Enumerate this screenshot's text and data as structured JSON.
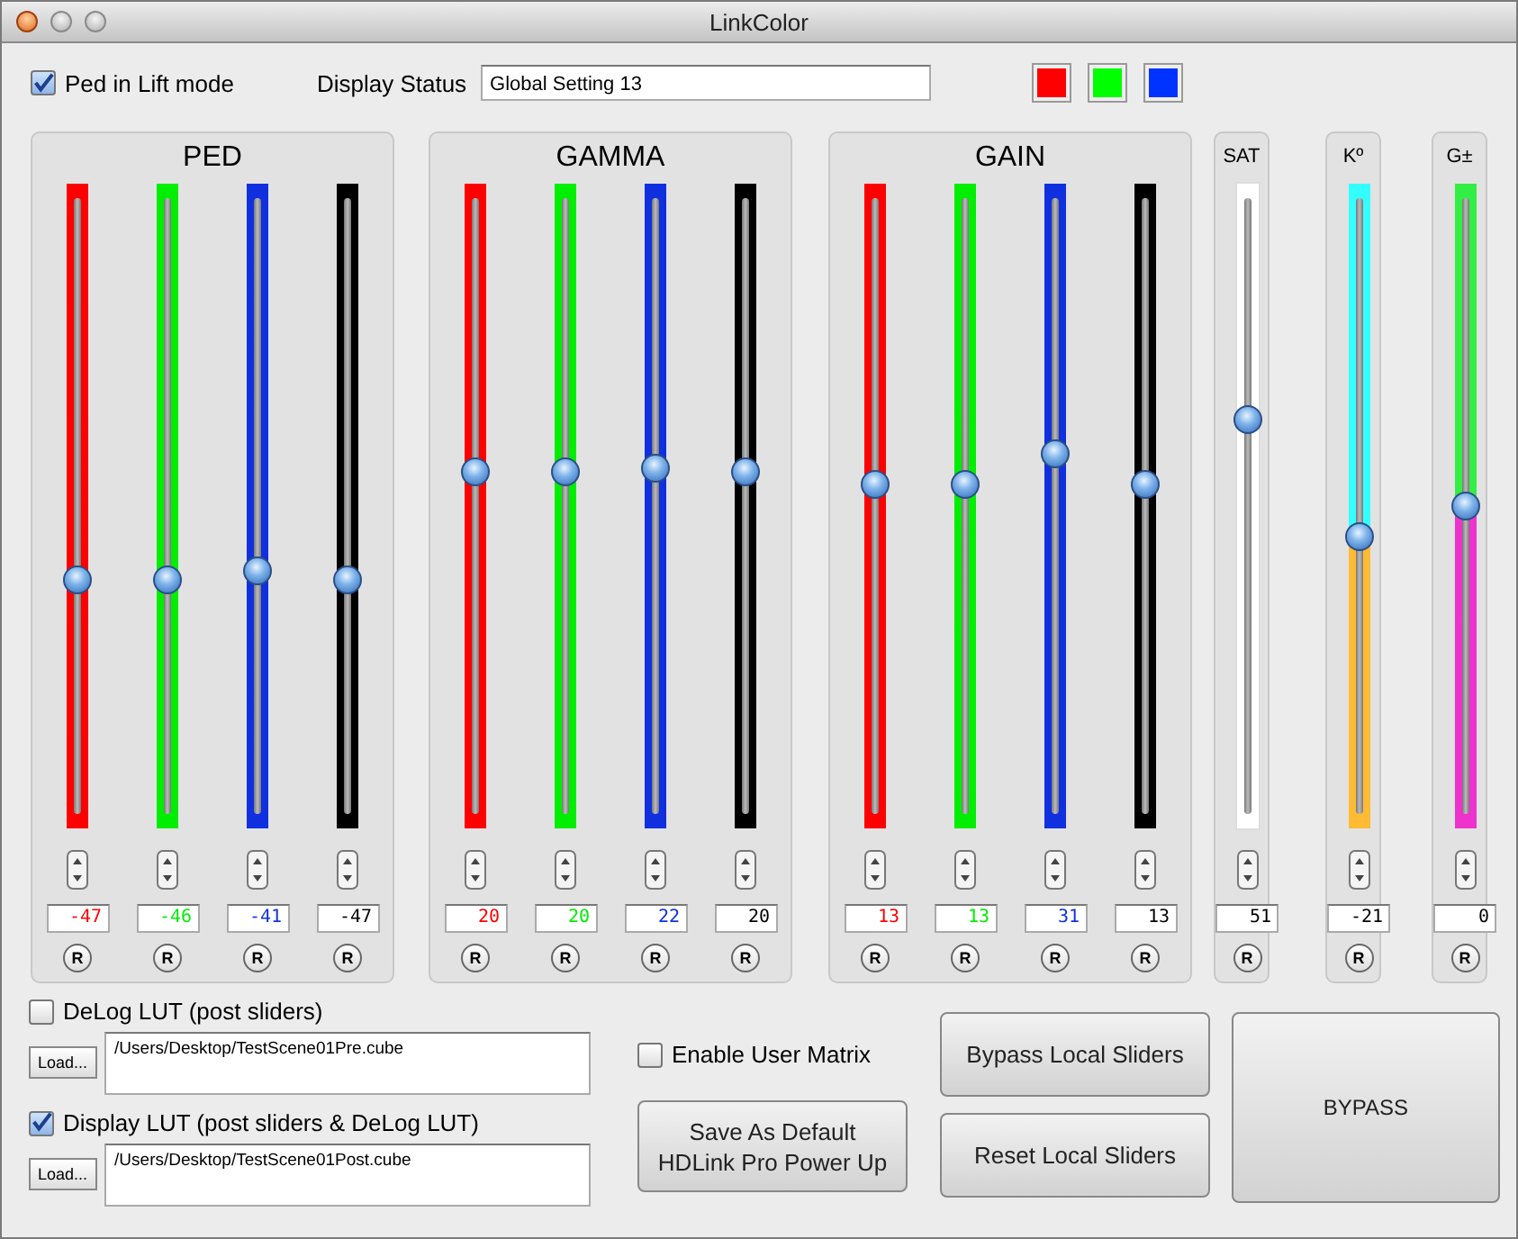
{
  "window": {
    "title": "LinkColor"
  },
  "top": {
    "ped_lift": {
      "label": "Ped in Lift mode",
      "checked": true
    },
    "status_label": "Display Status",
    "status_value": "Global Setting 13",
    "swatches": [
      {
        "color": "#ff0000"
      },
      {
        "color": "#00ff00"
      },
      {
        "color": "#0033ff"
      }
    ]
  },
  "groups": [
    {
      "title": "PED",
      "kind": "rgb",
      "channels": [
        {
          "color": "#ff0000",
          "level": 0.38,
          "value": "-47",
          "reset": "R"
        },
        {
          "color": "#00ee00",
          "level": 0.38,
          "value": "-46",
          "reset": "R"
        },
        {
          "color": "#1030e0",
          "level": 0.395,
          "value": "-41",
          "reset": "R"
        },
        {
          "color": "#000000",
          "level": 0.38,
          "value": "-47",
          "reset": "R"
        }
      ]
    },
    {
      "title": "GAMMA",
      "kind": "rgb",
      "channels": [
        {
          "color": "#ff0000",
          "level": 0.555,
          "value": "20",
          "reset": "R"
        },
        {
          "color": "#00ee00",
          "level": 0.555,
          "value": "20",
          "reset": "R"
        },
        {
          "color": "#1030e0",
          "level": 0.56,
          "value": "22",
          "reset": "R"
        },
        {
          "color": "#000000",
          "level": 0.555,
          "value": "20",
          "reset": "R"
        }
      ]
    },
    {
      "title": "GAIN",
      "kind": "rgb",
      "channels": [
        {
          "color": "#ff0000",
          "level": 0.535,
          "value": "13",
          "reset": "R"
        },
        {
          "color": "#00ee00",
          "level": 0.535,
          "value": "13",
          "reset": "R"
        },
        {
          "color": "#1030e0",
          "level": 0.585,
          "value": "31",
          "reset": "R"
        },
        {
          "color": "#000000",
          "level": 0.535,
          "value": "13",
          "reset": "R"
        }
      ]
    },
    {
      "title": "SAT",
      "kind": "single",
      "channels": [
        {
          "color": "#ffffff",
          "level": 0.64,
          "value": "51",
          "reset": "R"
        }
      ]
    },
    {
      "title": "Kº",
      "kind": "single",
      "channels": [
        {
          "segments": [
            {
              "color": "#33ffff"
            },
            {
              "color": "#ffbb33"
            }
          ],
          "level": 0.45,
          "value": "-21",
          "reset": "R"
        }
      ]
    },
    {
      "title": "G±",
      "kind": "single",
      "channels": [
        {
          "segments": [
            {
              "color": "#33ee44"
            },
            {
              "color": "#ee33cc"
            }
          ],
          "level": 0.5,
          "value": "0",
          "reset": "R"
        }
      ]
    }
  ],
  "bottom": {
    "delog": {
      "label": "DeLog LUT (post sliders)",
      "checked": false,
      "load": "Load...",
      "path": "/Users/Desktop/TestScene01Pre.cube"
    },
    "display_lut": {
      "label": "Display LUT (post sliders & DeLog LUT)",
      "checked": true,
      "load": "Load...",
      "path": "/Users/Desktop/TestScene01Post.cube"
    },
    "user_matrix": {
      "label": "Enable User Matrix",
      "checked": false
    },
    "save": "Save As Default\nHDLink Pro Power Up",
    "bypass_local": "Bypass Local Sliders",
    "reset_local": "Reset Local Sliders",
    "bypass": "BYPASS"
  }
}
